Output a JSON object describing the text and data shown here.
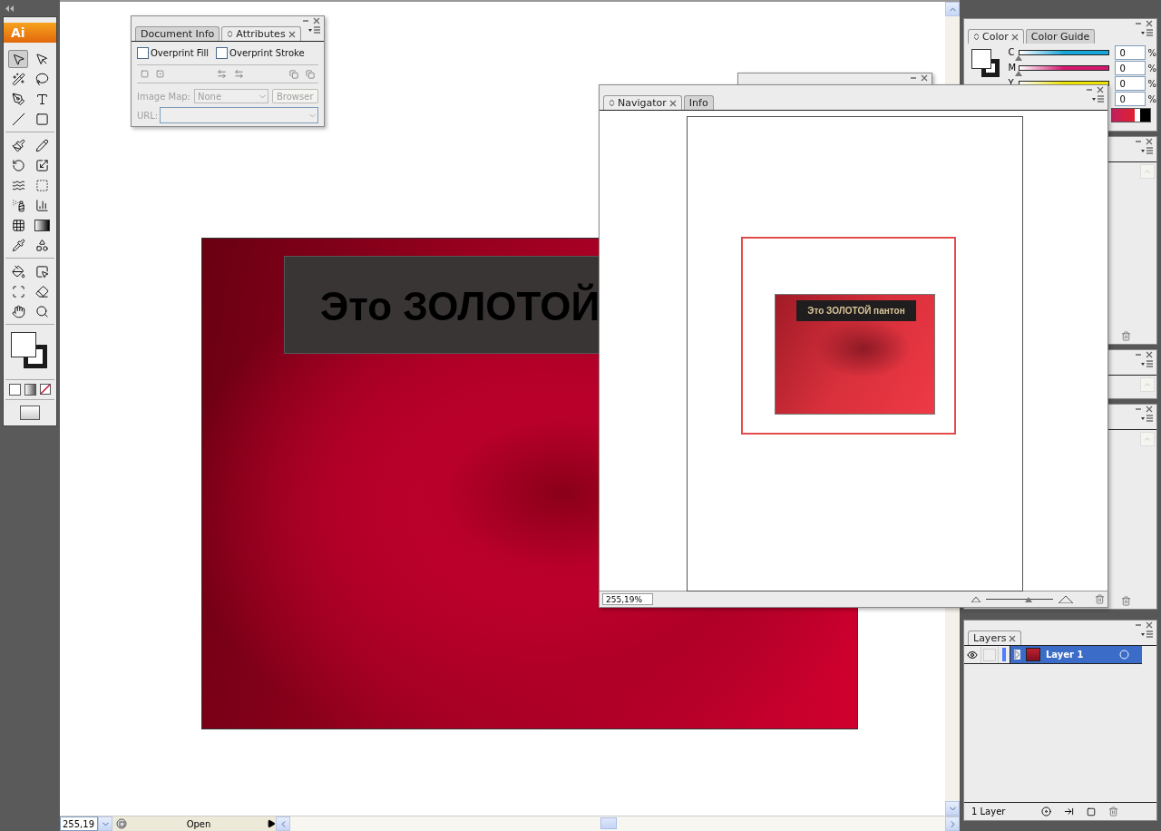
{
  "toolbox": {
    "logo": "Ai",
    "tools": [
      {
        "selected": true
      },
      {
        "selected": false
      },
      {
        "selected": false
      },
      {
        "selected": false
      },
      {
        "selected": false
      },
      {
        "selected": false
      },
      {
        "selected": false
      },
      {
        "selected": false
      },
      {
        "selected": false
      },
      {
        "selected": false
      },
      {
        "selected": false
      },
      {
        "selected": false
      },
      {
        "selected": false
      },
      {
        "selected": false
      },
      {
        "selected": false
      },
      {
        "selected": false
      },
      {
        "selected": false
      },
      {
        "selected": false
      },
      {
        "selected": false
      },
      {
        "selected": false
      },
      {
        "selected": false
      },
      {
        "selected": false
      },
      {
        "selected": false
      },
      {
        "selected": false
      },
      {
        "selected": false
      },
      {
        "selected": false
      }
    ]
  },
  "attributes_panel": {
    "tabs": [
      {
        "label": "Document Info",
        "selected": false
      },
      {
        "label": "Attributes",
        "selected": true
      }
    ],
    "options": [
      {
        "label": "Overprint Fill",
        "checked": false
      },
      {
        "label": "Overprint Stroke",
        "checked": false
      }
    ],
    "image_map": {
      "label": "Image Map:",
      "value": "None",
      "disabled": true
    },
    "browser_button": {
      "label": "Browser",
      "disabled": true
    },
    "url": {
      "label": "URL:",
      "disabled": true
    }
  },
  "artboard": {
    "heading": "Это ЗОЛОТОЙ"
  },
  "navigator": {
    "tabs": [
      {
        "label": "Navigator",
        "selected": true
      },
      {
        "label": "Info",
        "selected": false
      }
    ],
    "preview_heading": "Это ЗОЛОТОЙ пантон",
    "zoom": "255,19%",
    "zoom_slider": {
      "level": 0.63
    }
  },
  "color_panel": {
    "tabs": [
      {
        "label": "Color",
        "selected": true
      },
      {
        "label": "Color Guide",
        "selected": false
      }
    ],
    "channels": [
      {
        "label": "C",
        "value": "0",
        "unit": "%",
        "level": 0,
        "color": "#17a6da"
      },
      {
        "label": "M",
        "value": "0",
        "unit": "%",
        "level": 0,
        "color": "#d4176f"
      },
      {
        "label": "Y",
        "value": "0",
        "unit": "%",
        "color": "#f2e600"
      },
      {
        "value": "0",
        "unit": "%"
      }
    ]
  },
  "layers_panel": {
    "tabs": [
      {
        "label": "Layers",
        "selected": true
      }
    ],
    "layers": [
      {
        "name": "Layer 1",
        "selected": true,
        "visible": true,
        "color": "#4f7dff"
      }
    ],
    "count": "1 Layer"
  },
  "status_bar": {
    "zoom": "255,19",
    "status": "Open"
  }
}
